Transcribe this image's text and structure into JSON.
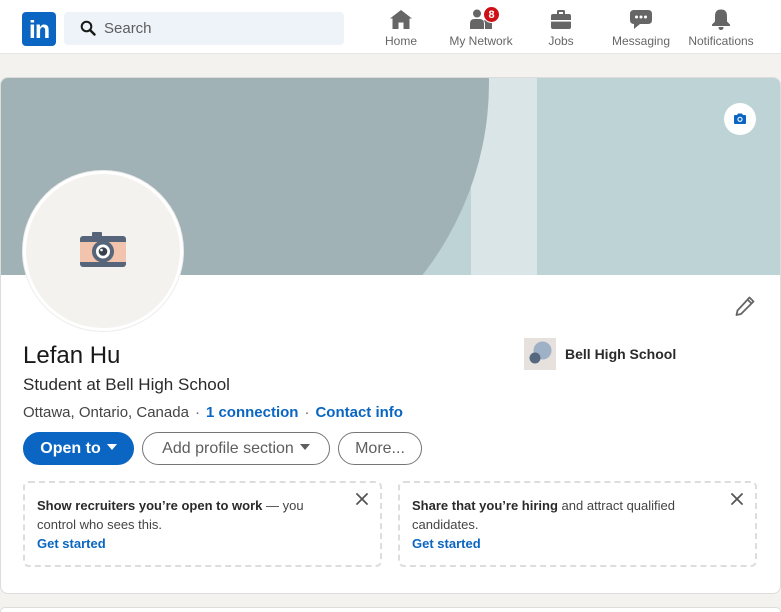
{
  "nav": {
    "logo": "in",
    "search": {
      "placeholder": "Search"
    },
    "items": [
      {
        "label": "Home",
        "icon": "home-icon"
      },
      {
        "label": "My Network",
        "icon": "people-icon",
        "badge": "8"
      },
      {
        "label": "Jobs",
        "icon": "briefcase-icon"
      },
      {
        "label": "Messaging",
        "icon": "chat-bubble-icon"
      },
      {
        "label": "Notifications",
        "icon": "bell-icon"
      }
    ]
  },
  "profile": {
    "cover_icon": "camera-icon",
    "avatar_icon": "camera-icon",
    "edit_icon": "pencil-icon",
    "name": "Lefan Hu",
    "headline": "Student at Bell High School",
    "location": "Ottawa, Ontario, Canada",
    "separator": "·",
    "connections": "1 connection",
    "contact_info": "Contact info",
    "school": "Bell High School",
    "buttons": {
      "open_to": "Open to",
      "add_section": "Add profile section",
      "more": "More..."
    }
  },
  "promos": [
    {
      "bold": "Show recruiters you’re open to work",
      "rest": " — you control who sees this.",
      "link": "Get started"
    },
    {
      "bold": "Share that you’re hiring",
      "rest": " and attract qualified candidates.",
      "link": "Get started"
    }
  ],
  "colors": {
    "brand": "#0a66c2",
    "badge": "#cc1016",
    "cover_dark": "#a0b2b5",
    "cover_light": "#bdd3d6"
  }
}
